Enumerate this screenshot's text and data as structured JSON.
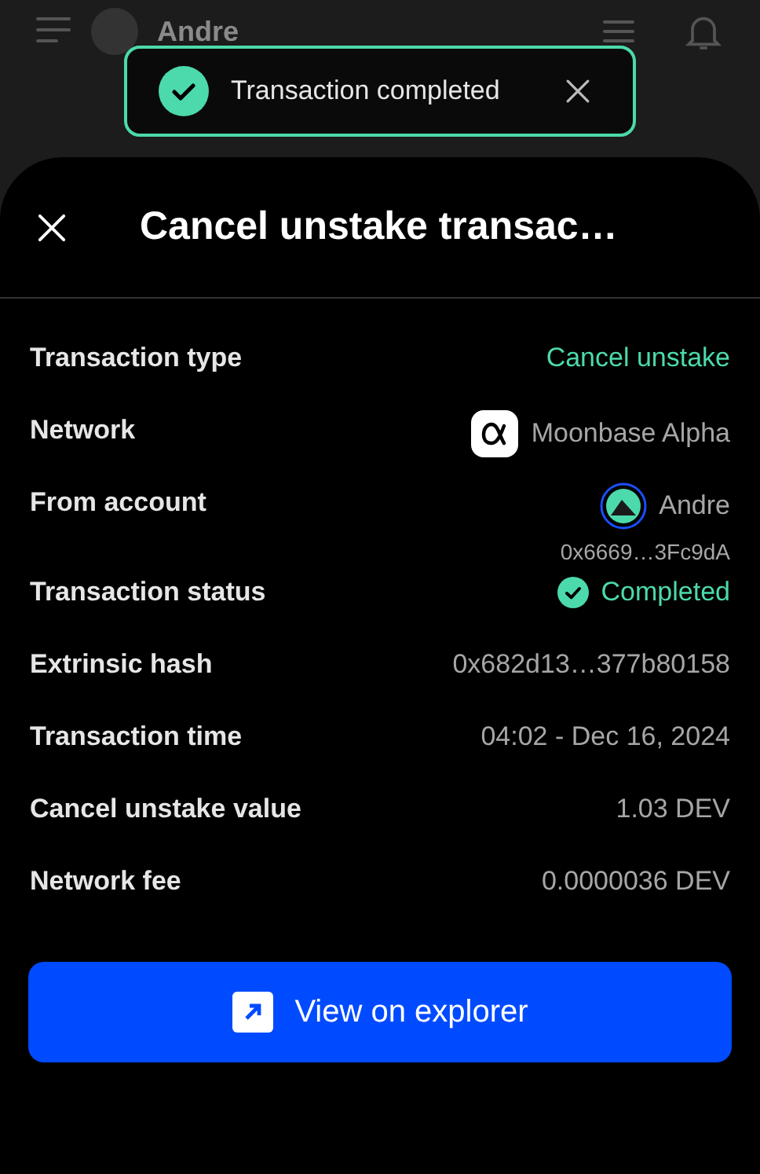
{
  "header": {
    "account_name": "Andre"
  },
  "toast": {
    "message": "Transaction completed"
  },
  "sheet": {
    "title": "Cancel unstake transac…",
    "rows": [
      {
        "kind": "text",
        "label": "Transaction type",
        "value": "Cancel unstake",
        "color": "#4cd9ac"
      },
      {
        "kind": "network",
        "label": "Network",
        "value": "Moonbase Alpha",
        "color": "#a6a6a6"
      },
      {
        "kind": "account",
        "label": "From account",
        "value": "Andre",
        "address": "0x6669…3Fc9dA",
        "color": "#a6a6a6"
      },
      {
        "kind": "status",
        "label": "Transaction status",
        "value": "Completed",
        "color": "#4cd9ac"
      },
      {
        "kind": "text",
        "label": "Extrinsic hash",
        "value": "0x682d13…377b80158",
        "color": "#a6a6a6"
      },
      {
        "kind": "text",
        "label": "Transaction time",
        "value": "04:02 - Dec 16, 2024",
        "color": "#a6a6a6"
      },
      {
        "kind": "text",
        "label": "Cancel unstake value",
        "value": "1.03 DEV",
        "color": "#a6a6a6"
      },
      {
        "kind": "text",
        "label": "Network fee",
        "value": "0.0000036 DEV",
        "color": "#a6a6a6"
      }
    ],
    "button": "View on explorer"
  }
}
